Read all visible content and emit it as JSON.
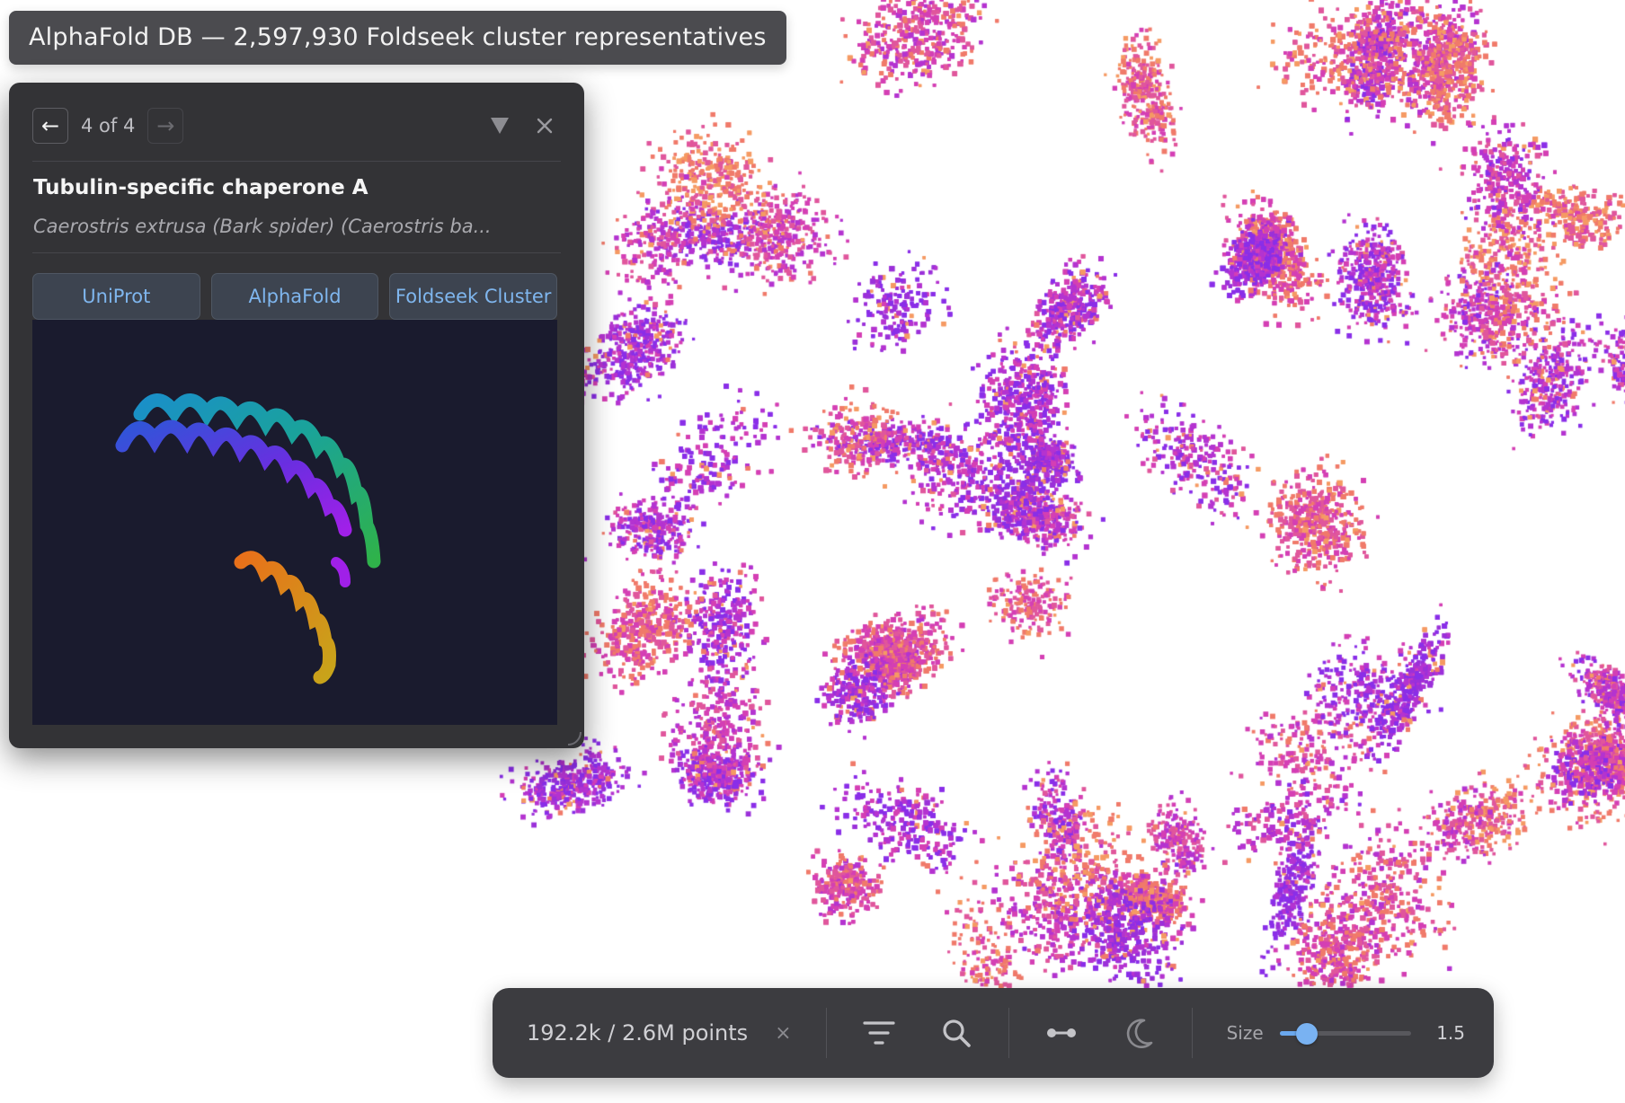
{
  "title": "AlphaFold DB — 2,597,930 Foldseek cluster representatives",
  "panel": {
    "prev_icon": "←",
    "next_icon": "→",
    "counter": "4 of 4",
    "filter_icon": "▼",
    "close_icon": "✕",
    "protein_name": "Tubulin-specific chaperone A",
    "organism": "Caerostris extrusa (Bark spider) (Caerostris ba...",
    "links": [
      {
        "label": "UniProt"
      },
      {
        "label": "AlphaFold"
      },
      {
        "label": "Foldseek Cluster"
      }
    ],
    "icons": {
      "prev": "left-arrow-icon",
      "next": "right-arrow-icon",
      "filter": "filter-funnel-icon",
      "close": "close-icon",
      "resize": "resize-grip-icon"
    }
  },
  "toolbar": {
    "points": "192.2k / 2.6M points",
    "clear_icon": "×",
    "size_label": "Size",
    "size_value": "1.5",
    "size_slider_fraction": 0.19,
    "icons": [
      "filter-lines-icon",
      "search-icon",
      "connect-icon",
      "moon-icon"
    ]
  },
  "colors": {
    "panel_bg": "#333336",
    "accent": "#79b2f2",
    "scatter_purple": "#9b30d9",
    "scatter_magenta": "#d43fb4",
    "scatter_orange": "#f07a6a"
  }
}
